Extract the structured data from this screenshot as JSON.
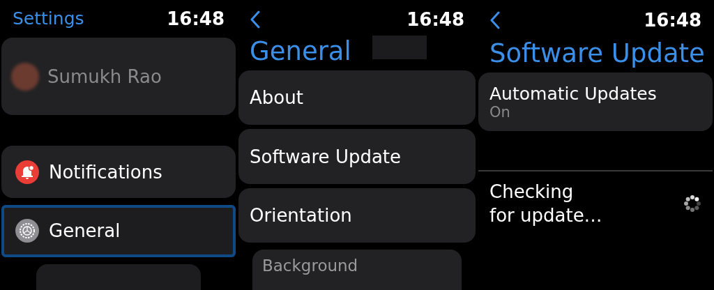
{
  "settings_screen": {
    "title": "Settings",
    "time": "16:48",
    "profile": {
      "name": "Sumukh Rao"
    },
    "items": [
      {
        "label": "Notifications",
        "selected": false
      },
      {
        "label": "General",
        "selected": true
      }
    ]
  },
  "general_screen": {
    "time": "16:48",
    "title": "General",
    "items": [
      {
        "label": "About",
        "selected": false
      },
      {
        "label": "Software Update",
        "selected": false
      },
      {
        "label": "Orientation",
        "selected": false
      }
    ],
    "partial_item": "Background"
  },
  "software_update_screen": {
    "time": "16:48",
    "title": "Software Update",
    "automatic_updates": {
      "label": "Automatic Updates",
      "value": "On"
    },
    "status": "Checking\nfor update…"
  }
}
